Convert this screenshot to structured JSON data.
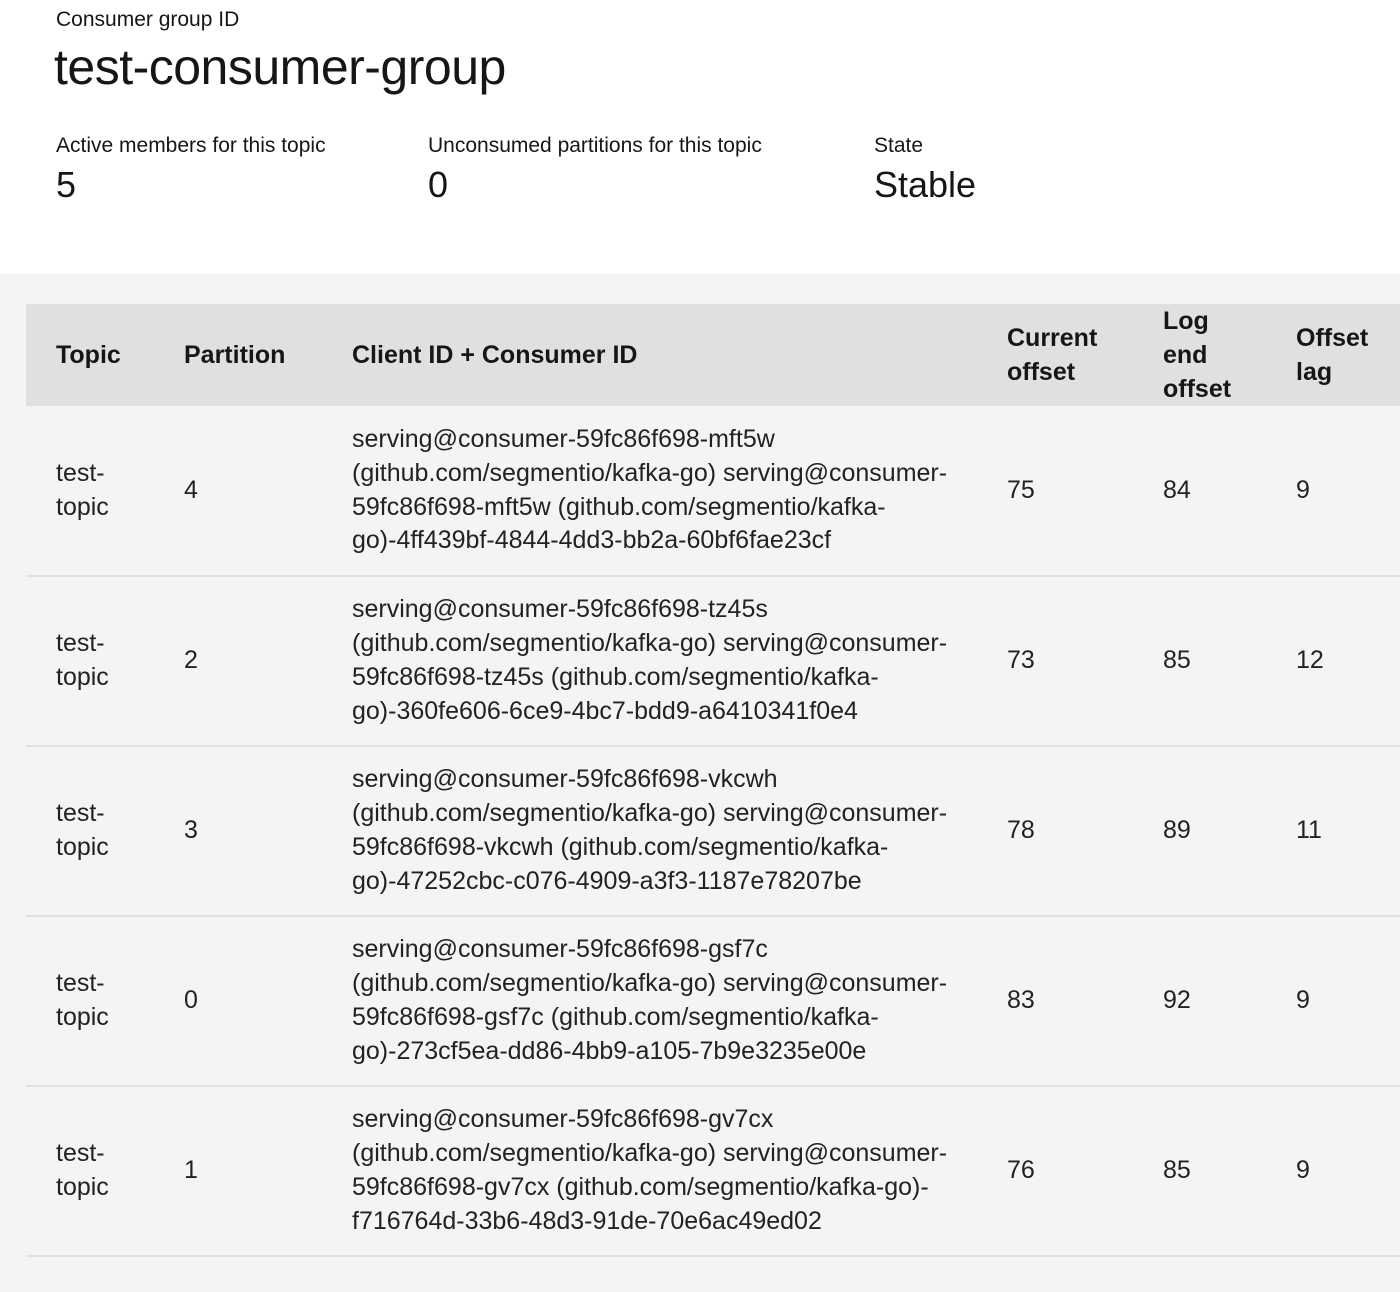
{
  "header": {
    "group_label": "Consumer group ID",
    "group_id": "test-consumer-group",
    "stats": {
      "active_members_label": "Active members for this topic",
      "active_members_value": "5",
      "unconsumed_label": "Unconsumed partitions for this topic",
      "unconsumed_value": "0",
      "state_label": "State",
      "state_value": "Stable"
    }
  },
  "table": {
    "columns": {
      "topic": "Topic",
      "partition": "Partition",
      "client": "Client ID + Consumer ID",
      "current_offset": "Current offset",
      "log_end_offset": "Log end offset",
      "offset_lag": "Offset lag"
    },
    "rows": [
      {
        "topic": "test-topic",
        "partition": "4",
        "client": "serving@consumer-59fc86f698-mft5w (github.com/segmentio/kafka-go) serving@consumer-59fc86f698-mft5w (github.com/segmentio/kafka-go)-4ff439bf-4844-4dd3-bb2a-60bf6fae23cf",
        "current_offset": "75",
        "log_end_offset": "84",
        "offset_lag": "9"
      },
      {
        "topic": "test-topic",
        "partition": "2",
        "client": "serving@consumer-59fc86f698-tz45s (github.com/segmentio/kafka-go) serving@consumer-59fc86f698-tz45s (github.com/segmentio/kafka-go)-360fe606-6ce9-4bc7-bdd9-a6410341f0e4",
        "current_offset": "73",
        "log_end_offset": "85",
        "offset_lag": "12"
      },
      {
        "topic": "test-topic",
        "partition": "3",
        "client": "serving@consumer-59fc86f698-vkcwh (github.com/segmentio/kafka-go) serving@consumer-59fc86f698-vkcwh (github.com/segmentio/kafka-go)-47252cbc-c076-4909-a3f3-1187e78207be",
        "current_offset": "78",
        "log_end_offset": "89",
        "offset_lag": "11"
      },
      {
        "topic": "test-topic",
        "partition": "0",
        "client": "serving@consumer-59fc86f698-gsf7c (github.com/segmentio/kafka-go) serving@consumer-59fc86f698-gsf7c (github.com/segmentio/kafka-go)-273cf5ea-dd86-4bb9-a105-7b9e3235e00e",
        "current_offset": "83",
        "log_end_offset": "92",
        "offset_lag": "9"
      },
      {
        "topic": "test-topic",
        "partition": "1",
        "client": "serving@consumer-59fc86f698-gv7cx (github.com/segmentio/kafka-go) serving@consumer-59fc86f698-gv7cx (github.com/segmentio/kafka-go)-f716764d-33b6-48d3-91de-70e6ac49ed02",
        "current_offset": "76",
        "log_end_offset": "85",
        "offset_lag": "9"
      }
    ]
  }
}
